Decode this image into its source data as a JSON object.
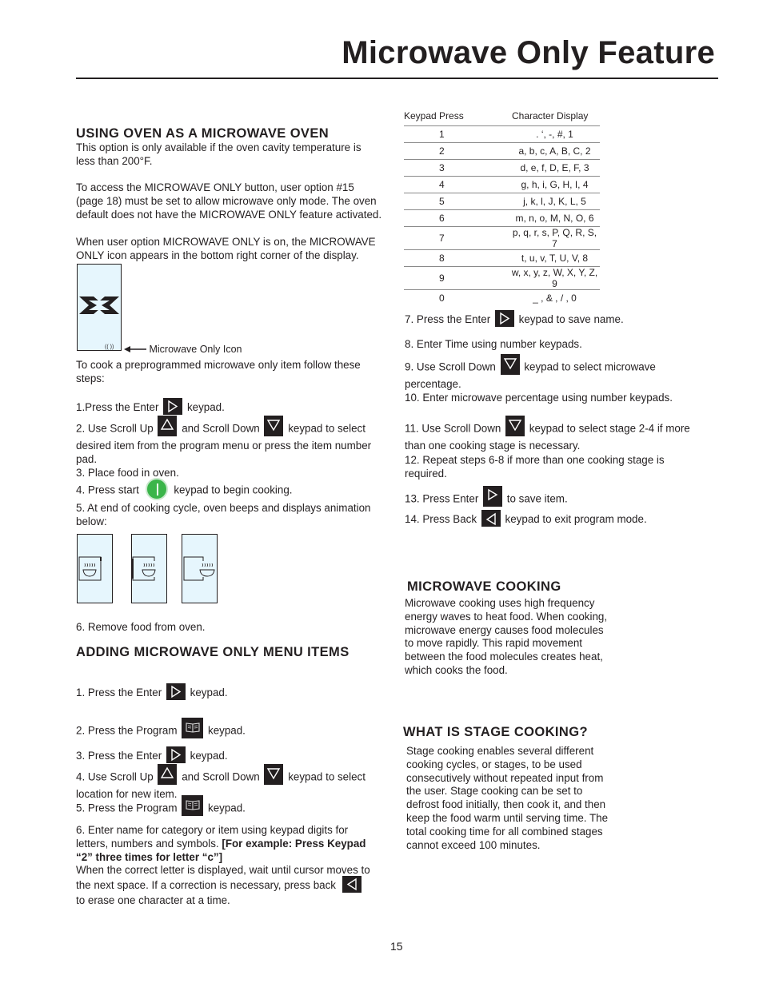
{
  "page": {
    "title": "Microwave Only Feature",
    "page_number": "15"
  },
  "left": {
    "section1": {
      "heading": "USING OVEN AS A MICROWAVE OVEN",
      "para1_line1": "This option is only available if the oven cavity temperature is",
      "para1_line2": "less than 200°F.",
      "para2_line1": "To access the MICROWAVE ONLY button, user option #15",
      "para2_line2": "(page 18) must be set to allow microwave only mode. The oven",
      "para2_line3": "default does not have the MICROWAVE ONLY feature activated.",
      "para3_line1": "When user option MICROWAVE ONLY is on, the MICROWAVE",
      "para3_line2": "ONLY icon appears in the bottom right corner of the display.",
      "icon_caption": "Microwave Only Icon",
      "cook_intro_line1": "To cook a preprogrammed microwave only item follow these",
      "cook_intro_line2": "steps:",
      "step1_a": "1.Press the Enter",
      "step1_b": "keypad.",
      "step2_a": "2.  Use Scroll Up",
      "step2_b": "and Scroll Down",
      "step2_c": "keypad to select",
      "step2_line2": "desired item from the program menu or press the item number",
      "step2_line3": "pad.",
      "step3": "3.  Place food in oven.",
      "step4_a": "4. Press start",
      "step4_b": "keypad to begin cooking.",
      "step5_line1": "5. At end of cooking cycle, oven beeps and displays animation",
      "step5_line2": "below:",
      "step6": "6. Remove food from oven."
    },
    "section2": {
      "heading": "ADDING MICROWAVE ONLY MENU ITEMS",
      "s1_a": "1.  Press the Enter",
      "s1_b": "keypad.",
      "s2_a": "2.  Press the Program",
      "s2_b": "keypad.",
      "s3_a": "3.  Press the Enter",
      "s3_b": "keypad.",
      "s4_a": "4. Use Scroll Up",
      "s4_b": "and Scroll Down",
      "s4_c": "keypad to select",
      "s4_line2": "location for new item.",
      "s5_a": "5.  Press the Program",
      "s5_b": "keypad.",
      "s6_line1": "6.  Enter name for category or item using keypad digits for",
      "s6_line2_a": "letters, numbers and symbols.",
      "s6_line2_b": "[For example:  Press Keypad",
      "s6_line3": "“2”  three times for letter “c”]",
      "s6_line4": "When the correct letter is displayed, wait until cursor moves to",
      "s6_line5": "the next space. If a correction is necessary, press back",
      "s6_line6": "to erase one character at a time."
    }
  },
  "keypad_table": {
    "headers": [
      "Keypad Press",
      "Character Display"
    ],
    "rows": [
      [
        "1",
        ". ‘, -, #, 1"
      ],
      [
        "2",
        "a, b, c, A, B, C, 2"
      ],
      [
        "3",
        "d, e, f, D, E, F, 3"
      ],
      [
        "4",
        "g, h, i, G, H, I, 4"
      ],
      [
        "5",
        "j, k, l, J, K, L, 5"
      ],
      [
        "6",
        "m, n, o, M, N, O, 6"
      ],
      [
        "7",
        "p, q, r, s, P, Q, R, S, 7"
      ],
      [
        "8",
        "t, u, v, T, U, V, 8"
      ],
      [
        "9",
        "w, x, y, z, W, X, Y, Z, 9"
      ],
      [
        "0",
        "_ , & , / , 0"
      ]
    ]
  },
  "right": {
    "s7_a": "7. Press the Enter",
    "s7_b": "keypad to save name.",
    "s8": "8. Enter Time using number keypads.",
    "s9_a": "9. Use Scroll Down",
    "s9_b": "keypad to select microwave",
    "s9_line2": "percentage.",
    "s10": "10. Enter microwave percentage using number keypads.",
    "s11_a": "11. Use Scroll Down",
    "s11_b": "keypad to select stage 2-4 if more",
    "s11_line2": "than one cooking stage is necessary.",
    "s12_line1": "12.  Repeat steps 6-8 if more than one cooking stage is",
    "s12_line2": "required.",
    "s13_a": "13. Press Enter",
    "s13_b": "to save item.",
    "s14_a": "14. Press Back",
    "s14_b": "keypad to exit program mode.",
    "microwave_cooking": {
      "heading": "MICROWAVE COOKING",
      "lines": [
        "Microwave cooking uses high frequency",
        "energy waves to heat food. When cooking,",
        "microwave energy causes food molecules",
        "to move rapidly. This rapid movement",
        "between the food molecules creates heat,",
        "which cooks the food."
      ]
    },
    "stage_cooking": {
      "heading": "WHAT IS STAGE COOKING?",
      "lines": [
        "Stage cooking enables several different",
        "cooking cycles, or stages, to be used",
        "consecutively without repeated input from",
        "the user. Stage cooking can be set to",
        "defrost food initially, then cook it, and then",
        "keep the food warm until serving time. The",
        "total cooking time for all combined stages",
        "cannot exceed 100 minutes."
      ]
    }
  },
  "icons": {
    "enter": "enter-right-triangle-icon",
    "scroll_up": "scroll-up-triangle-icon",
    "scroll_down": "scroll-down-triangle-icon",
    "back": "back-left-triangle-icon",
    "program": "program-book-icon",
    "start": "start-green-circle-icon"
  },
  "colors": {
    "text": "#231f20",
    "screen_bg": "#e6f6fd",
    "start_green": "#3bb54a"
  }
}
